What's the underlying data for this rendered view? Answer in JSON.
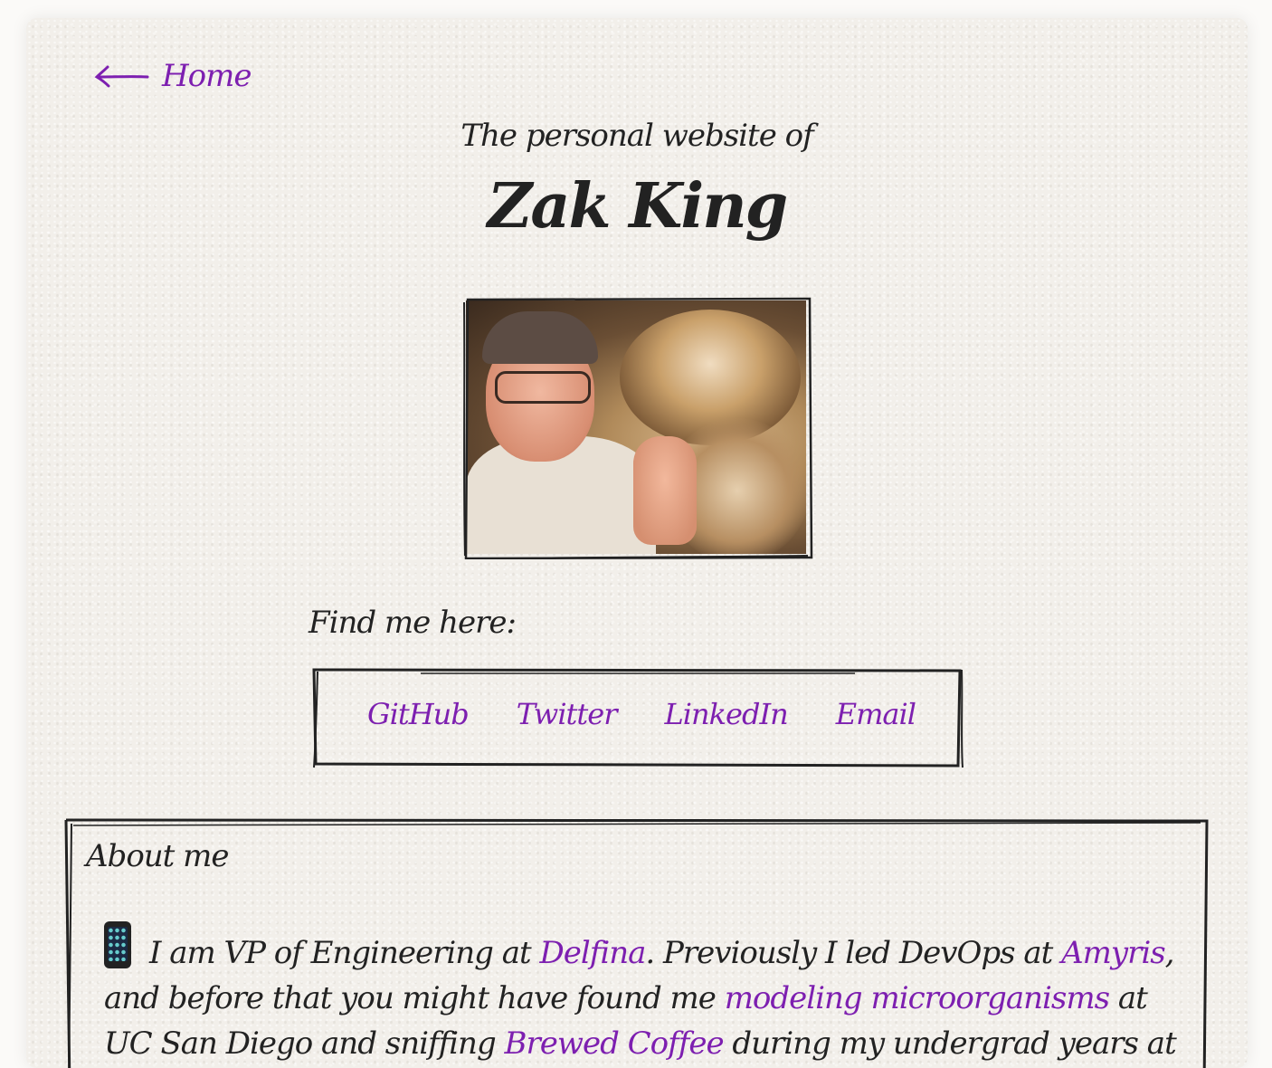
{
  "nav": {
    "home_label": "Home"
  },
  "header": {
    "subtitle": "The personal website of",
    "name": "Zak King"
  },
  "photo": {
    "alt": "Zak King giving a thumbs up in a cave"
  },
  "links": {
    "label": "Find me here:",
    "items": [
      "GitHub",
      "Twitter",
      "LinkedIn",
      "Email"
    ]
  },
  "about": {
    "title": "About me",
    "segments": {
      "s1": "I am VP of Engineering at ",
      "l1": "Delfina",
      "s2": ". Previously I led DevOps at ",
      "l2": "Amyris",
      "s3": ", and before that you might have found me ",
      "l3": "modeling microorganisms",
      "s4": " at UC San Diego and sniffing ",
      "l4": "Brewed Coffee",
      "s5": " during my undergrad years at UofM (Go Blue!)."
    }
  },
  "colors": {
    "link": "#7d1fb0",
    "text": "#222222",
    "paper": "#f2efea"
  }
}
